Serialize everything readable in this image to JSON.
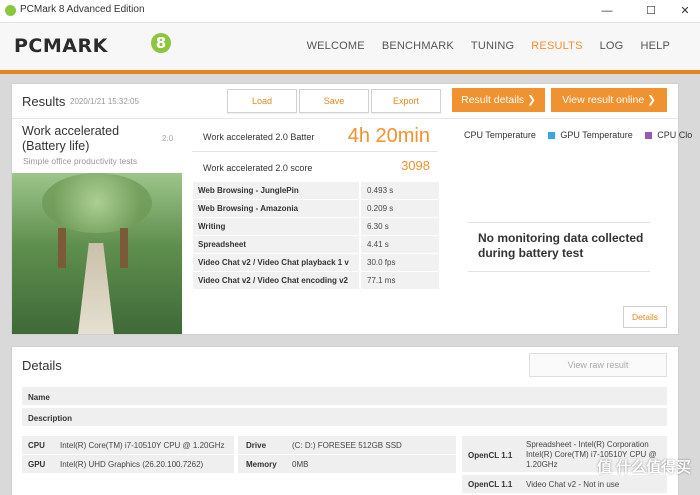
{
  "window": {
    "title": "PCMark 8 Advanced Edition",
    "minimize": "—",
    "maximize": "☐",
    "close": "✕"
  },
  "brand": {
    "logo_text": "PCMARK",
    "logo_mark": "8"
  },
  "nav": [
    "WELCOME",
    "BENCHMARK",
    "TUNING",
    "RESULTS",
    "LOG",
    "HELP"
  ],
  "results": {
    "title": "Results",
    "date": "2020/1/21 15:32:05",
    "buttons": {
      "load": "Load",
      "save": "Save",
      "export": "Export",
      "result_details": "Result details ❯",
      "view_online": "View result online ❯"
    },
    "test": {
      "name": "Work accelerated (Battery life)",
      "version": "2.0",
      "description": "Simple office productivity tests"
    },
    "score": {
      "main_label": "Work accelerated 2.0 Batter",
      "main_value": "4h 20min",
      "sub_label": "Work accelerated 2.0 score",
      "sub_value": "3098"
    },
    "metrics": [
      {
        "name": "Web Browsing - JunglePin",
        "value": "0.493 s"
      },
      {
        "name": "Web Browsing - Amazonia",
        "value": "0.209 s"
      },
      {
        "name": "Writing",
        "value": "6.30 s"
      },
      {
        "name": "Spreadsheet",
        "value": "4.41 s"
      },
      {
        "name": "Video Chat v2 / Video Chat playback 1 v",
        "value": "30.0 fps"
      },
      {
        "name": "Video Chat v2 / Video Chat encoding v2",
        "value": "77.1 ms"
      }
    ],
    "legend": [
      {
        "label": "CPU Temperature",
        "color": "#ffffff"
      },
      {
        "label": "GPU Temperature",
        "color": "#3aa8e0"
      },
      {
        "label": "CPU Clo",
        "color": "#9b59b6"
      }
    ],
    "monitor_message": "No monitoring data collected during battery test",
    "details_button": "Details"
  },
  "details": {
    "title": "Details",
    "view_raw": "View raw result",
    "name_label": "Name",
    "description_label": "Description",
    "cpu_label": "CPU",
    "cpu_value": "Intel(R) Core(TM) i7-10510Y CPU @ 1.20GHz",
    "gpu_label": "GPU",
    "gpu_value": "Intel(R) UHD Graphics (26.20.100.7262)",
    "drive_label": "Drive",
    "drive_value": "(C: D:) FORESEE 512GB SSD",
    "memory_label": "Memory",
    "memory_value": "0MB",
    "opencl_label": "OpenCL 1.1",
    "opencl_value_1": "Spreadsheet - Intel(R) Corporation Intel(R) Core(TM) i7-10510Y CPU @ 1.20GHz",
    "opencl_value_2": "Video Chat v2 - Not in use"
  },
  "watermark": "值 什么值得买"
}
